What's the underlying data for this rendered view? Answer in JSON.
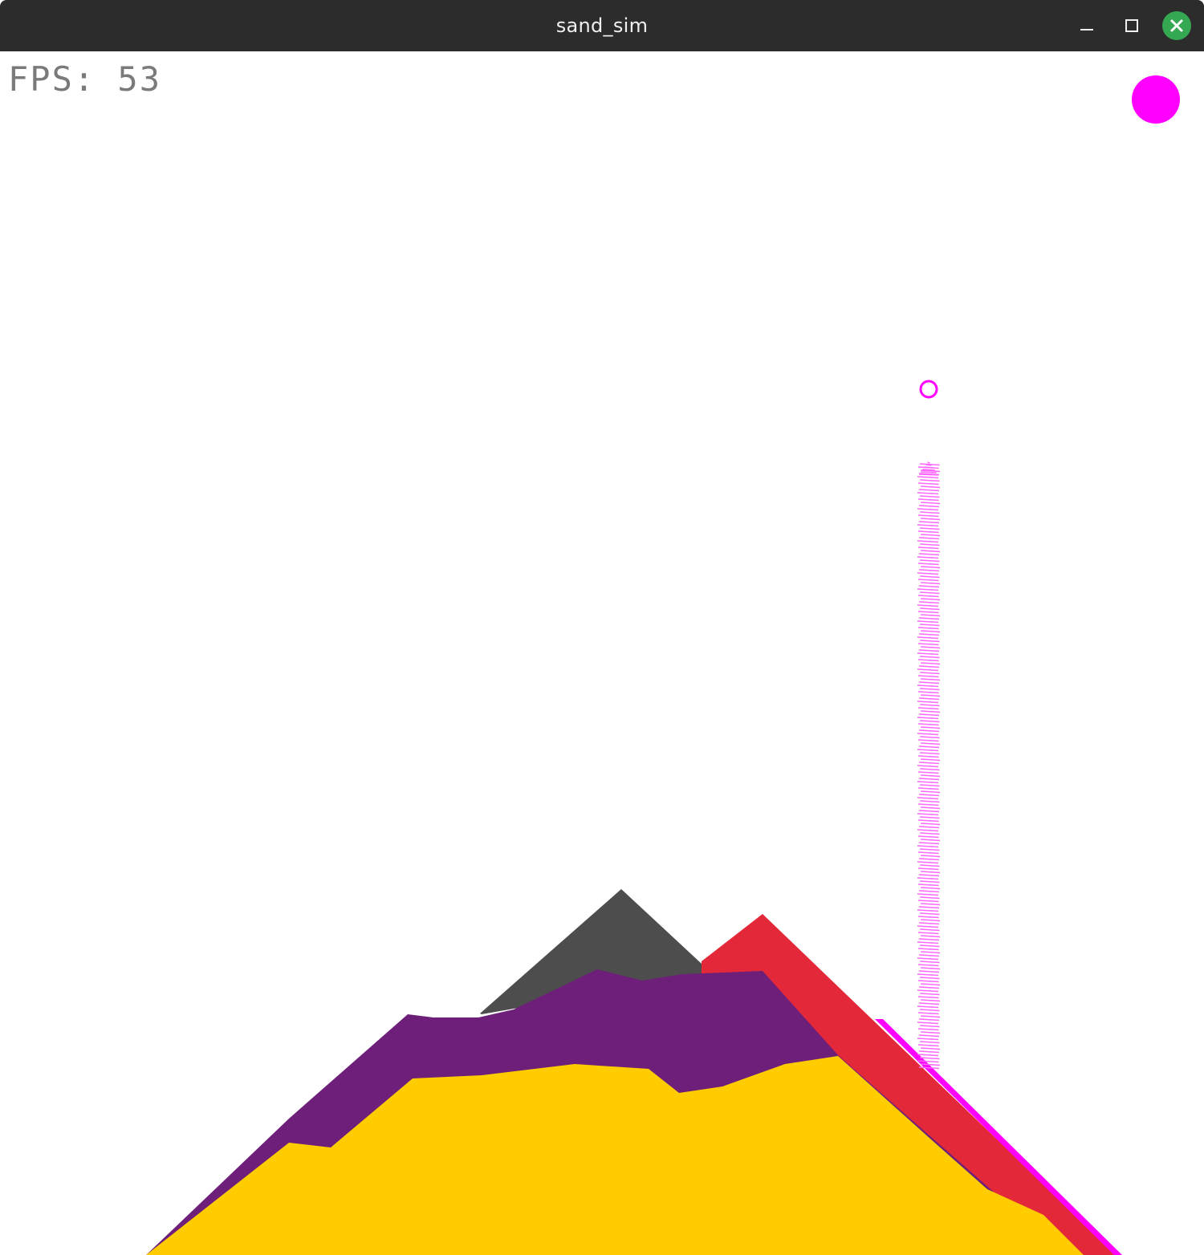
{
  "window": {
    "title": "sand_sim"
  },
  "hud": {
    "fps_text": "FPS: 53",
    "fps_value": 53,
    "selected_material_color": "#ff00ff"
  },
  "colors": {
    "background": "#ffffff",
    "titlebar": "#2c2c2c",
    "close_button": "#35a852",
    "stone": "#4d4d4d",
    "purple_sand": "#6d1f7a",
    "red_sand": "#e3283a",
    "yellow_sand": "#ffcc00",
    "magenta_particles": "#ff00ff",
    "magenta_stream": "#ff66ff"
  },
  "icons": {
    "minimize": "minimize-icon",
    "maximize": "maximize-icon",
    "close": "close-icon",
    "brush_cursor": "brush-cursor-icon",
    "material_swatch": "material-swatch-icon"
  }
}
